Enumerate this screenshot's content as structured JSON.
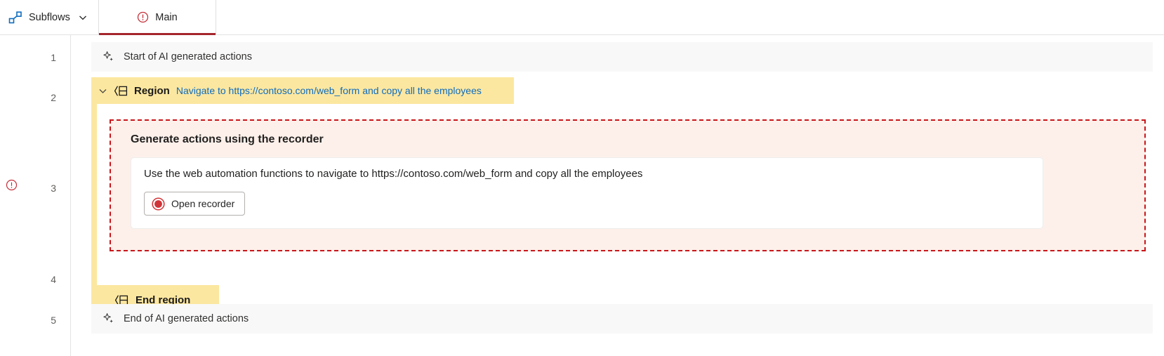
{
  "header": {
    "subflows": {
      "label": "Subflows",
      "icon": "subflow-icon",
      "chevron": "chevron-down-icon"
    },
    "tabs": [
      {
        "label": "Main",
        "icon": "error-circle-icon",
        "active": true
      }
    ]
  },
  "gutter": {
    "line_numbers": [
      "1",
      "2",
      "3",
      "4",
      "5"
    ],
    "error_marker_line": "3",
    "error_icon": "error-circle-icon"
  },
  "rows": {
    "start_ai": {
      "label": "Start of AI generated actions",
      "icon": "ai-sparkle-icon"
    },
    "region": {
      "chevron": "chevron-down-icon",
      "icon": "region-icon",
      "keyword": "Region",
      "description": "Navigate to https://contoso.com/web_form and copy all the employees"
    },
    "end_region": {
      "icon": "region-icon",
      "keyword": "End region"
    },
    "end_ai": {
      "label": "End of AI generated actions",
      "icon": "ai-sparkle-icon"
    }
  },
  "recorder": {
    "title": "Generate actions using the recorder",
    "prompt": "Use the web automation functions to navigate to https://contoso.com/web_form and copy all the employees",
    "button": {
      "label": "Open recorder",
      "icon": "record-circle-icon"
    }
  },
  "colors": {
    "region_yellow": "#FCE7A0",
    "recorder_bg": "#FDF0EA",
    "recorder_border": "#C8151A",
    "link_blue": "#0F6CBD",
    "tab_underline": "#A4262C",
    "ai_row_bg": "#F8F8F8",
    "record_red": "#D13438"
  }
}
